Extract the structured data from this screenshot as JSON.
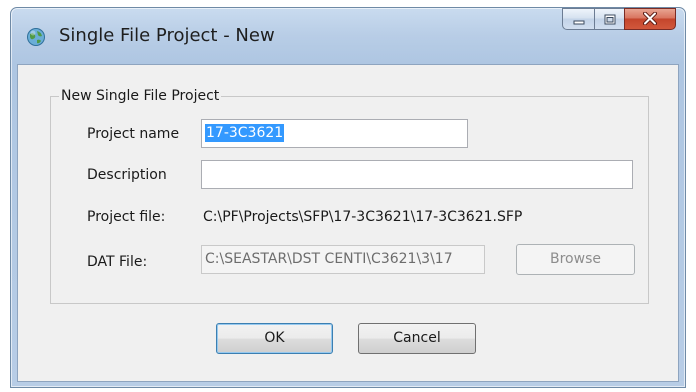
{
  "window": {
    "title": "Single File Project - New",
    "icon": "globe-icon"
  },
  "caption_buttons": {
    "minimize": "minimize-icon",
    "maximize": "maximize-icon",
    "close": "close-icon"
  },
  "group": {
    "title": "New Single File Project"
  },
  "form": {
    "project_name_label": "Project name",
    "project_name_value": "17-3C3621",
    "description_label": "Description",
    "description_value": "",
    "project_file_label": "Project file:",
    "project_file_value": "C:\\PF\\Projects\\SFP\\17-3C3621\\17-3C3621.SFP",
    "dat_file_label": "DAT File:",
    "dat_file_value": "C:\\SEASTAR\\DST CENTI\\C3621\\3\\17",
    "browse_label": "Browse"
  },
  "buttons": {
    "ok_label": "OK",
    "cancel_label": "Cancel"
  },
  "colors": {
    "selection": "#3399ff",
    "close_button": "#c4452c",
    "title_bar": "#b8cde6"
  }
}
